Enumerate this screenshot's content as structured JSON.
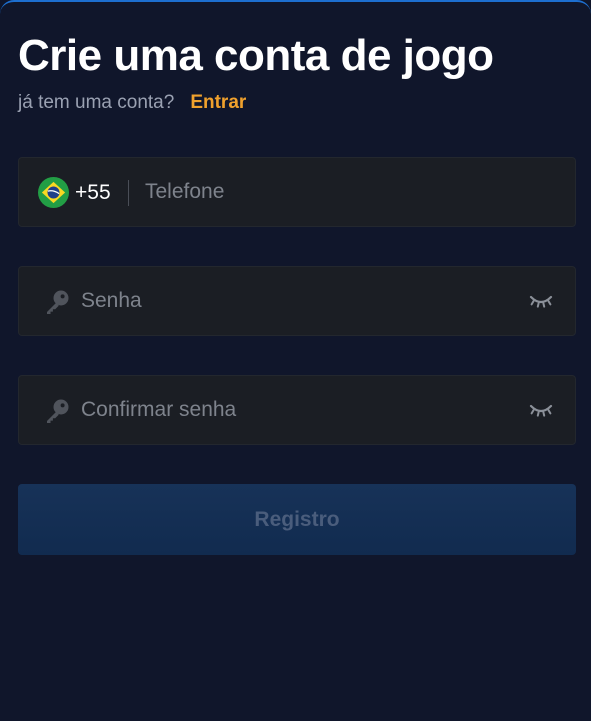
{
  "header": {
    "title": "Crie uma conta de jogo",
    "login_question": "já tem uma conta?",
    "login_link": "Entrar"
  },
  "phone_field": {
    "country_flag": "brazil-flag-icon",
    "country_code": "+55",
    "placeholder": "Telefone",
    "value": ""
  },
  "password_field": {
    "icon": "key-icon",
    "placeholder": "Senha",
    "value": "",
    "toggle_icon": "eye-closed-icon"
  },
  "confirm_password_field": {
    "icon": "key-icon",
    "placeholder": "Confirmar senha",
    "value": "",
    "toggle_icon": "eye-closed-icon"
  },
  "submit": {
    "label": "Registro"
  },
  "colors": {
    "background": "#10162b",
    "field_bg": "#1b1e24",
    "accent_link": "#f0a12d",
    "button_bg": "#15304f",
    "button_text": "#4a5d7c",
    "top_border": "#1d6fd0"
  }
}
